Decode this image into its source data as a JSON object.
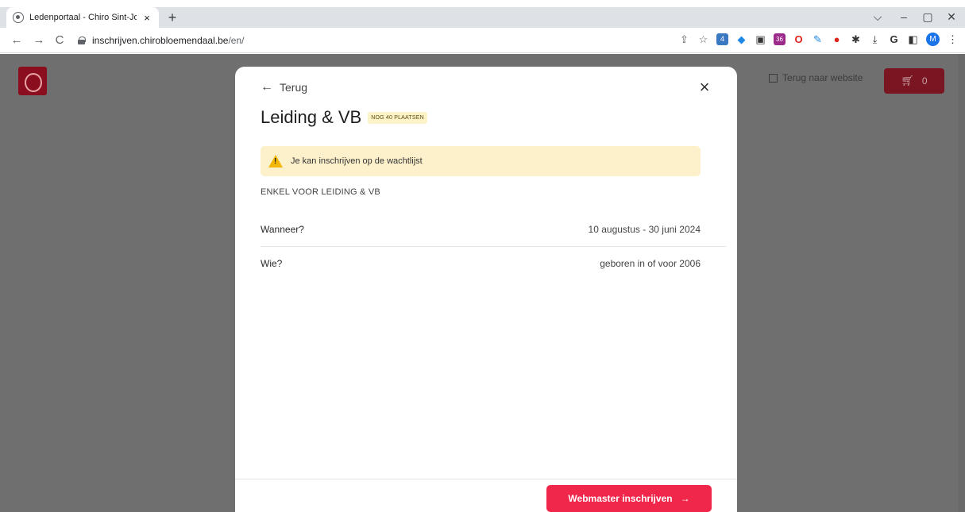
{
  "browser": {
    "tab_title": "Ledenportaal - Chiro Sint-Jozef B",
    "tab_close": "×",
    "new_tab": "+",
    "window_controls": [
      "⌵",
      "–",
      "▢",
      "✕"
    ],
    "nav": {
      "back": "←",
      "forward": "→",
      "reload": "C"
    },
    "url_domain": "inschrijven.chirobloemendaal.be",
    "url_path": "/en/",
    "extension_icons": [
      "share-icon",
      "star-icon",
      "extension-translate-icon",
      "extension-diamond-icon",
      "extension-window-icon",
      "extension-calendar-icon",
      "extension-opera-icon",
      "extension-pen-icon",
      "extension-circle-icon",
      "puzzle-icon",
      "download-icon",
      "g-icon",
      "sidepanel-icon"
    ],
    "extension_badges": {
      "translate": "4",
      "calendar": "36"
    },
    "g_label": "G",
    "profile_initial": "M"
  },
  "page": {
    "website_link": "Terug naar website",
    "cart_count": "0"
  },
  "modal": {
    "back_label": "Terug",
    "title": "Leiding & VB",
    "badge": "NOG 40 PLAATSEN",
    "alert_text": "Je kan inschrijven op de wachtlijst",
    "subtitle": "ENKEL VOOR LEIDING & VB",
    "rows": [
      {
        "label": "Wanneer?",
        "value": "10 augustus - 30 juni 2024"
      },
      {
        "label": "Wie?",
        "value": "geboren in of voor 2006"
      }
    ],
    "cta_label": "Webmaster inschrijven"
  },
  "colors": {
    "cta": "#f0264a",
    "alert_bg": "#fdf1cc",
    "badge_bg": "#fdf3c8",
    "overlay": "#6f6f6f",
    "cart_bg": "#7a1622"
  }
}
